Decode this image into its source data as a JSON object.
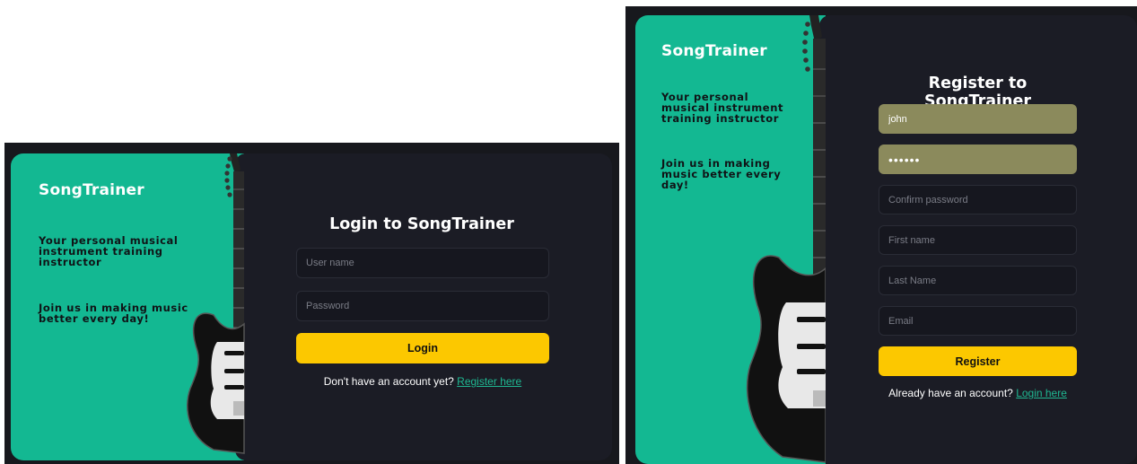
{
  "brand": "SongTrainer",
  "colors": {
    "green_panel": "#13b892",
    "dark_panel": "#1b1c25",
    "accent_button": "#fcc800",
    "link": "#1fb892"
  },
  "login": {
    "tagline": "Your personal musical instrument training instructor",
    "tagline2": "Join us in making music better every day!",
    "title": "Login to SongTrainer",
    "username_placeholder": "User name",
    "password_placeholder": "Password",
    "button": "Login",
    "footer_text": "Don't have an account yet?",
    "footer_link": "Register here"
  },
  "register": {
    "tagline": "Your personal musical instrument training instructor",
    "tagline2": "Join us in making music better every day!",
    "title": "Register to SongTrainer",
    "username_value": "john",
    "password_value": "••••••",
    "confirm_placeholder": "Confirm password",
    "firstname_placeholder": "First name",
    "lastname_placeholder": "Last Name",
    "email_placeholder": "Email",
    "button": "Register",
    "footer_text": "Already have an account?",
    "footer_link": "Login here"
  },
  "icons": [
    "electric-guitar-icon"
  ]
}
